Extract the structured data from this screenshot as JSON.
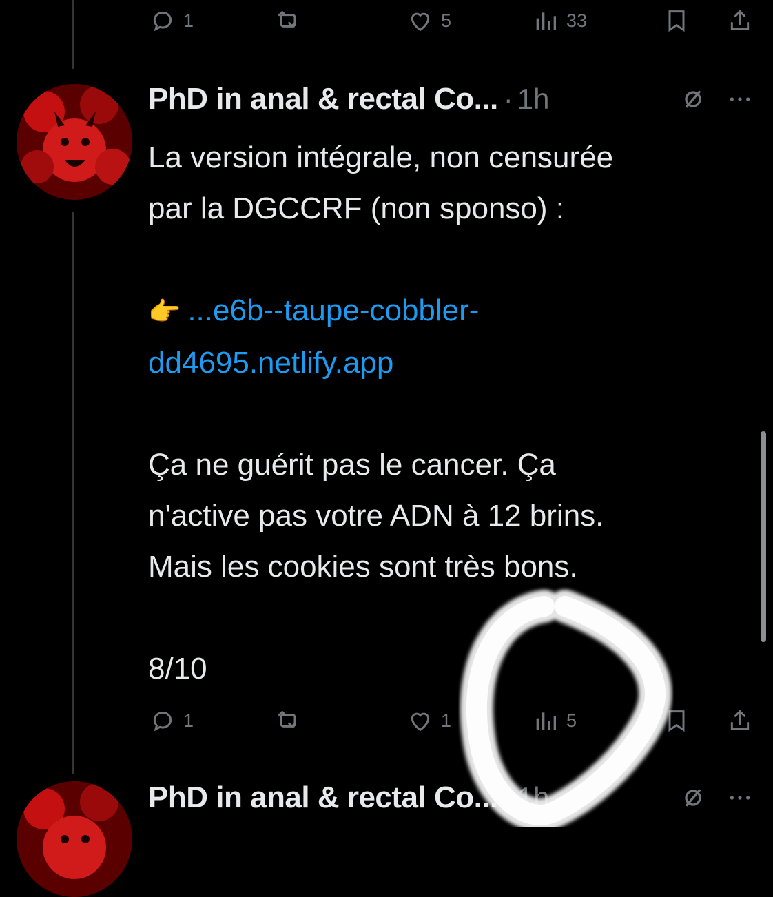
{
  "top_actions": {
    "replies": "1",
    "retweets": "",
    "likes": "5",
    "views": "33"
  },
  "tweet": {
    "author": "PhD in anal & rectal Co...",
    "separator": "·",
    "time": "1h",
    "body_line1": "La version intégrale, non censurée",
    "body_line2": "par la DGCCRF (non sponso) :",
    "emoji": "👉",
    "link_line1": "...e6b--taupe-cobbler-",
    "link_line2": "dd4695.netlify.app",
    "para3_line1": "Ça ne guérit pas le cancer. Ça",
    "para3_line2": "n'active pas votre ADN à 12 brins.",
    "para3_line3": "Mais les cookies sont très bons.",
    "counter": "8/10",
    "actions": {
      "replies": "1",
      "likes": "1",
      "views": "5"
    }
  },
  "next_tweet": {
    "author": "PhD in anal & rectal Co...",
    "separator": "·",
    "time": "1h"
  },
  "colors": {
    "background": "#000000",
    "text": "#e7e9ea",
    "muted": "#71767b",
    "link": "#1d9bf0"
  },
  "icons": [
    "reply-icon",
    "retweet-icon",
    "like-icon",
    "views-icon",
    "bookmark-icon",
    "share-icon",
    "grok-slash-icon",
    "more-icon",
    "point-right-emoji"
  ]
}
